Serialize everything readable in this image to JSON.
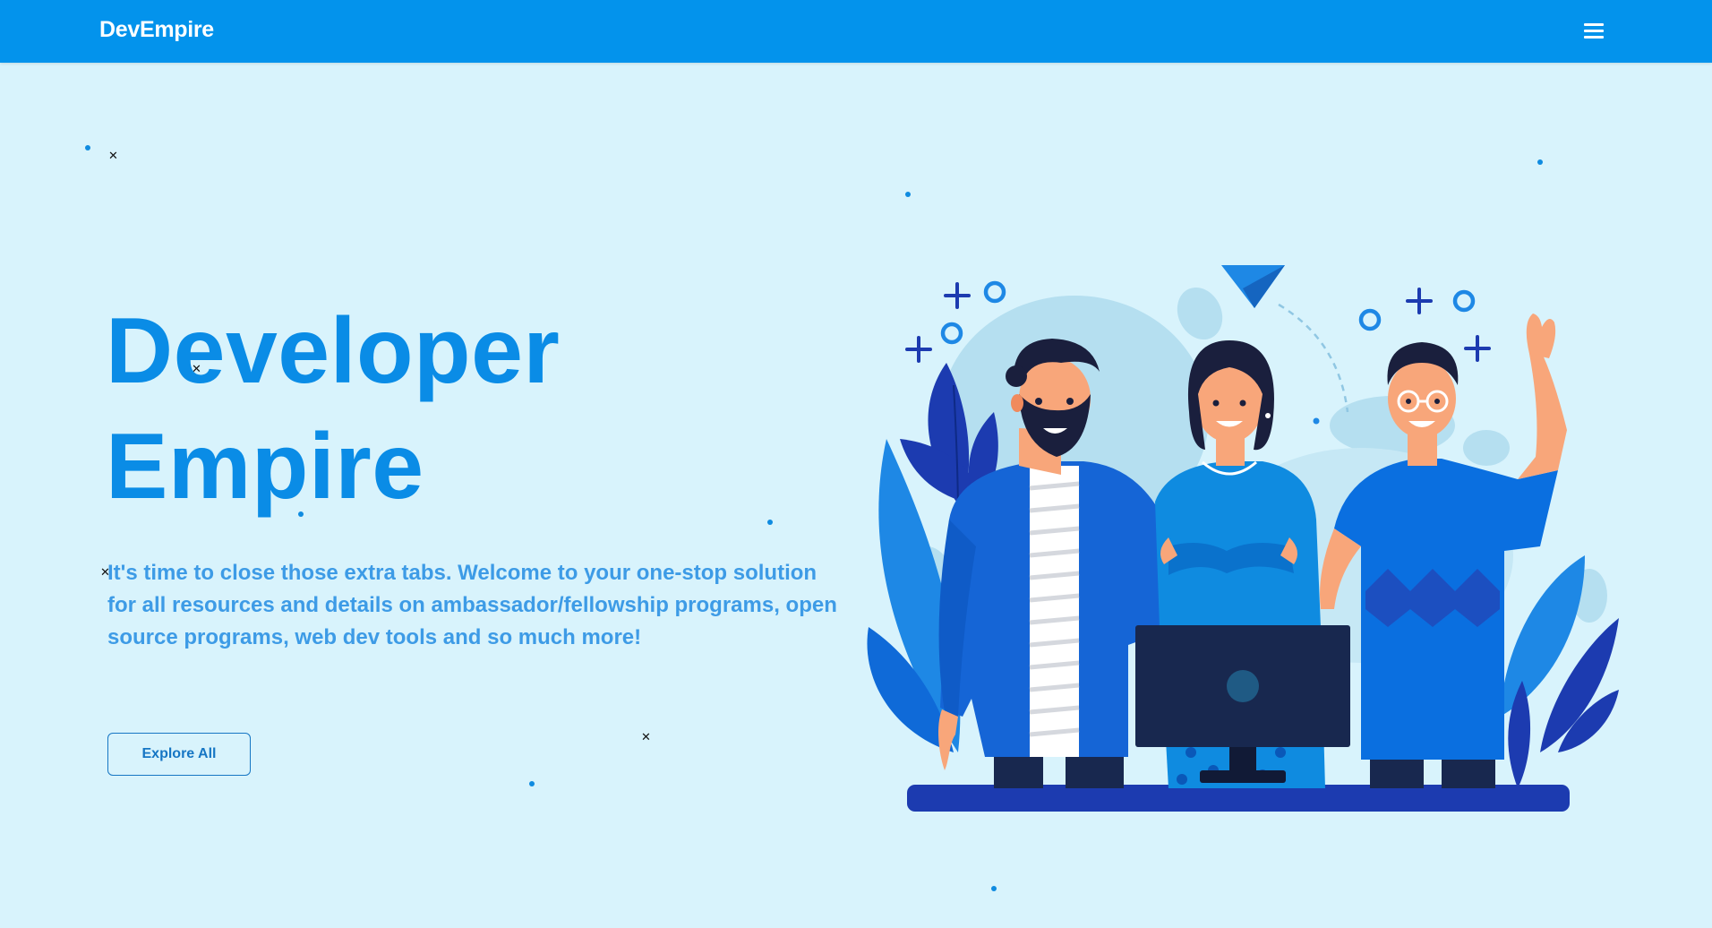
{
  "navbar": {
    "brand": "DevEmpire",
    "menu_icon": "hamburger-menu-icon",
    "background_color": "#0393ec"
  },
  "hero": {
    "title_line1": "Developer",
    "title_line2": "Empire",
    "description": "It's time to close those extra tabs. Welcome to your one-stop solution for all resources and details on ambassador/fellowship programs, open source programs, web dev tools and so much more!",
    "cta_label": "Explore All",
    "title_color": "#0a8ce6",
    "description_color": "#3d9be6"
  },
  "illustration": {
    "subject": "team-of-three-developers-illustration"
  },
  "colors": {
    "page_background": "#d8f3fc",
    "accent": "#0393ec",
    "button_border": "#1676c4"
  }
}
